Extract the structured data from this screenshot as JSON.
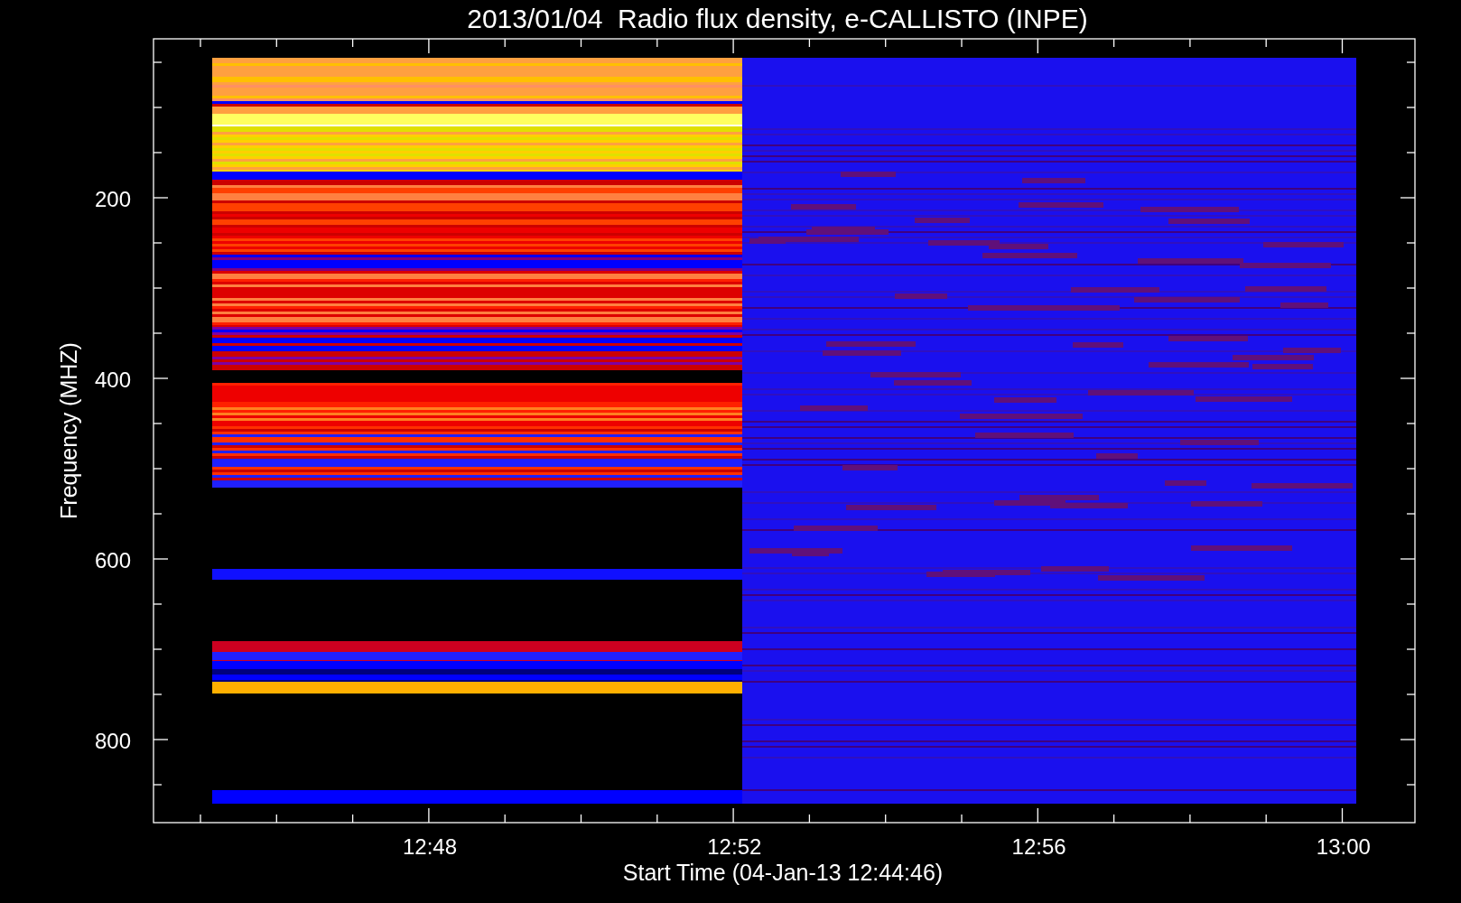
{
  "title": "2013/01/04  Radio flux density, e-CALLISTO (INPE)",
  "y_axis": {
    "label": "Frequency (MHZ)",
    "ticks": [
      "200",
      "400",
      "600",
      "800"
    ]
  },
  "x_axis": {
    "label": "Start Time (04-Jan-13 12:44:46)",
    "ticks": [
      "12:48",
      "12:52",
      "12:56",
      "13:00"
    ]
  }
}
